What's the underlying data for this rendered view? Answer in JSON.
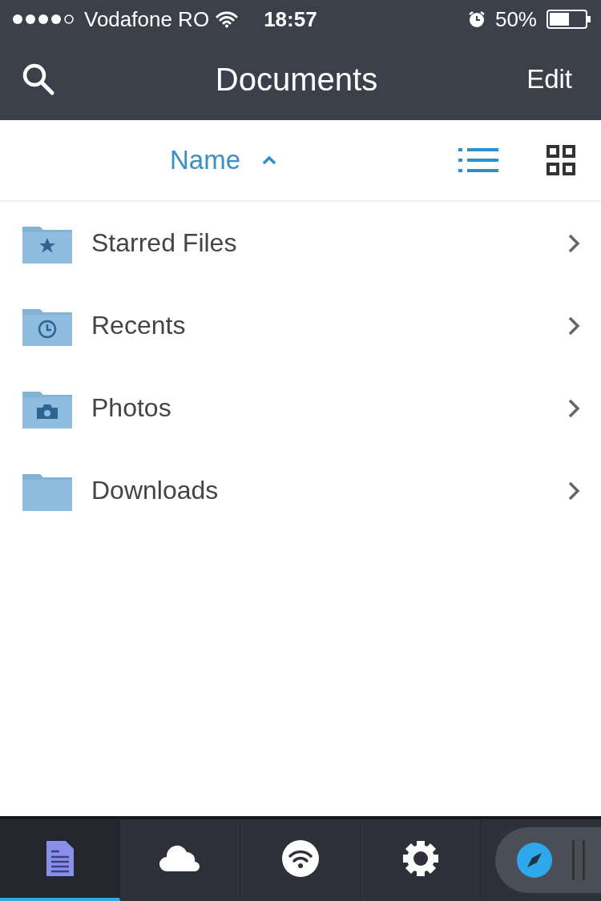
{
  "status_bar": {
    "carrier": "Vodafone RO",
    "time": "18:57",
    "battery": "50%"
  },
  "nav": {
    "title": "Documents",
    "edit": "Edit"
  },
  "sort": {
    "label": "Name",
    "ascending": true
  },
  "views": [
    {
      "kind": "list",
      "selected": true
    },
    {
      "kind": "grid",
      "selected": false
    }
  ],
  "folders": [
    {
      "name": "Starred Files",
      "kind": "star"
    },
    {
      "name": "Recents",
      "kind": "clock"
    },
    {
      "name": "Photos",
      "kind": "camera"
    },
    {
      "name": "Downloads",
      "kind": "plain"
    }
  ],
  "tabs": [
    {
      "kind": "documents",
      "selected": true
    },
    {
      "kind": "cloud",
      "selected": false
    },
    {
      "kind": "wifi",
      "selected": false
    },
    {
      "kind": "settings",
      "selected": false
    }
  ]
}
